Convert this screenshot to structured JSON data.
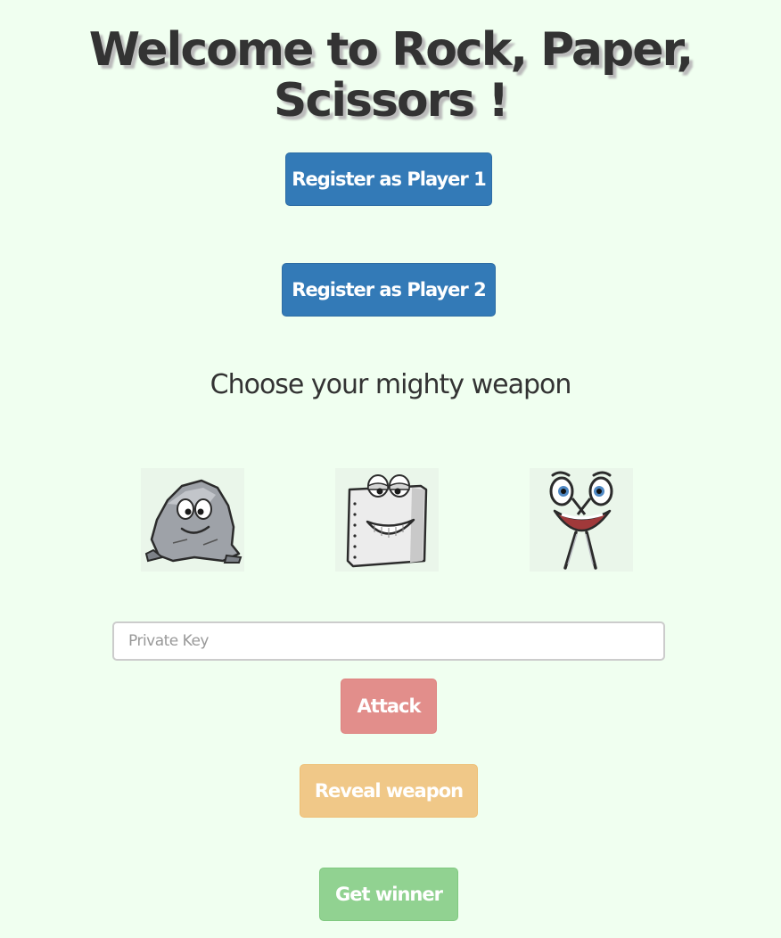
{
  "title": "Welcome to Rock, Paper, Scissors !",
  "buttons": {
    "register_p1": "Register as Player 1",
    "register_p2": "Register as Player 2",
    "attack": "Attack",
    "reveal": "Reveal weapon",
    "winner": "Get winner"
  },
  "weapons": {
    "heading": "Choose your mighty weapon",
    "items": [
      {
        "id": "rock",
        "icon": "rock-character-icon"
      },
      {
        "id": "paper",
        "icon": "paper-character-icon"
      },
      {
        "id": "scissors",
        "icon": "scissors-character-icon"
      }
    ]
  },
  "private_key": {
    "placeholder": "Private Key",
    "value": ""
  },
  "colors": {
    "background": "#f0fff0",
    "primary": "#337ab7",
    "attack": "#e28e8b",
    "reveal": "#f0c888",
    "winner": "#91d291"
  }
}
